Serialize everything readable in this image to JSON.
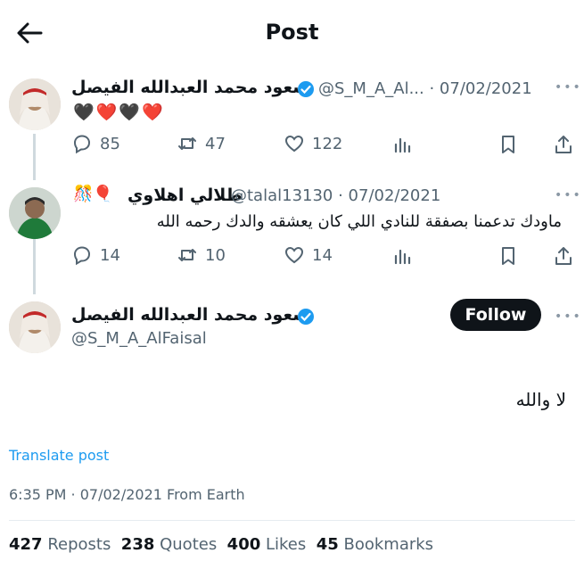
{
  "header": {
    "title": "Post"
  },
  "post1": {
    "author_name": "سعود محمد العبدالله الفيصل",
    "handle_date": "@S_M_A_Al... · 07/02/2021",
    "text": "🖤❤️🖤❤️",
    "replies": "85",
    "reposts": "47",
    "likes": "122"
  },
  "post2": {
    "author_name": "طلالي اهلاوي",
    "handle_date": "@talal13130 · 07/02/2021",
    "text": "ماودك تدعمنا بصفقة للنادي اللي كان يعشقه والدك رحمه الله",
    "replies": "14",
    "reposts": "10",
    "likes": "14"
  },
  "main_post": {
    "author_name": "سعود محمد العبدالله الفيصل",
    "handle": "@S_M_A_AlFaisal",
    "follow_label": "Follow",
    "text": "لا والله",
    "translate_label": "Translate post",
    "timestamp": "6:35 PM · 07/02/2021 From Earth",
    "stats": {
      "reposts_count": "427",
      "reposts_label": "Reposts",
      "quotes_count": "238",
      "quotes_label": "Quotes",
      "likes_count": "400",
      "likes_label": "Likes",
      "bookmarks_count": "45",
      "bookmarks_label": "Bookmarks"
    }
  },
  "colors": {
    "accent": "#1d9bf0",
    "text": "#0f1419",
    "muted": "#536471",
    "line": "#cfd9de"
  }
}
